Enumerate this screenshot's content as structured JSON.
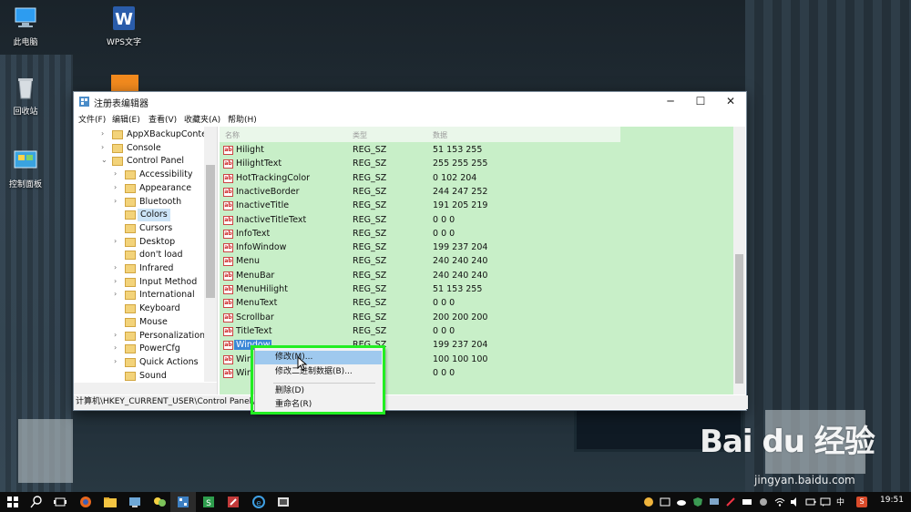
{
  "desktop": {
    "icons": [
      {
        "label": "此电脑",
        "name": "this-pc-icon"
      },
      {
        "label": "WPS文字",
        "name": "wps-writer-icon"
      },
      {
        "label": "回收站",
        "name": "recycle-bin-icon"
      },
      {
        "label": "控制面板",
        "name": "control-panel-icon"
      }
    ]
  },
  "window": {
    "title": "注册表编辑器",
    "buttons": {
      "minimize": "─",
      "maximize": "☐",
      "close": "✕"
    },
    "menu": [
      "文件(F)",
      "编辑(E)",
      "查看(V)",
      "收藏夹(A)",
      "帮助(H)"
    ]
  },
  "tree": {
    "nodes": [
      {
        "label": "AppXBackupConter",
        "level": 0,
        "arrow": "›"
      },
      {
        "label": "Console",
        "level": 0,
        "arrow": "›"
      },
      {
        "label": "Control Panel",
        "level": 0,
        "arrow": "⌄"
      },
      {
        "label": "Accessibility",
        "level": 1,
        "arrow": "›"
      },
      {
        "label": "Appearance",
        "level": 1,
        "arrow": "›"
      },
      {
        "label": "Bluetooth",
        "level": 1,
        "arrow": "›"
      },
      {
        "label": "Colors",
        "level": 1,
        "arrow": "",
        "selected": true
      },
      {
        "label": "Cursors",
        "level": 1,
        "arrow": ""
      },
      {
        "label": "Desktop",
        "level": 1,
        "arrow": "›"
      },
      {
        "label": "don't load",
        "level": 1,
        "arrow": ""
      },
      {
        "label": "Infrared",
        "level": 1,
        "arrow": "›"
      },
      {
        "label": "Input Method",
        "level": 1,
        "arrow": "›"
      },
      {
        "label": "International",
        "level": 1,
        "arrow": "›"
      },
      {
        "label": "Keyboard",
        "level": 1,
        "arrow": ""
      },
      {
        "label": "Mouse",
        "level": 1,
        "arrow": ""
      },
      {
        "label": "Personalization",
        "level": 1,
        "arrow": "›"
      },
      {
        "label": "PowerCfg",
        "level": 1,
        "arrow": "›"
      },
      {
        "label": "Quick Actions",
        "level": 1,
        "arrow": "›"
      },
      {
        "label": "Sound",
        "level": 1,
        "arrow": ""
      }
    ]
  },
  "list": {
    "headers": {
      "name": "名称",
      "type": "类型",
      "data": "数据"
    },
    "rows": [
      {
        "name": "Hilight",
        "type": "REG_SZ",
        "data": "51 153 255"
      },
      {
        "name": "HilightText",
        "type": "REG_SZ",
        "data": "255 255 255"
      },
      {
        "name": "HotTrackingColor",
        "type": "REG_SZ",
        "data": "0 102 204"
      },
      {
        "name": "InactiveBorder",
        "type": "REG_SZ",
        "data": "244 247 252"
      },
      {
        "name": "InactiveTitle",
        "type": "REG_SZ",
        "data": "191 205 219"
      },
      {
        "name": "InactiveTitleText",
        "type": "REG_SZ",
        "data": "0 0 0"
      },
      {
        "name": "InfoText",
        "type": "REG_SZ",
        "data": "0 0 0"
      },
      {
        "name": "InfoWindow",
        "type": "REG_SZ",
        "data": "199 237 204"
      },
      {
        "name": "Menu",
        "type": "REG_SZ",
        "data": "240 240 240"
      },
      {
        "name": "MenuBar",
        "type": "REG_SZ",
        "data": "240 240 240"
      },
      {
        "name": "MenuHilight",
        "type": "REG_SZ",
        "data": "51 153 255"
      },
      {
        "name": "MenuText",
        "type": "REG_SZ",
        "data": "0 0 0"
      },
      {
        "name": "Scrollbar",
        "type": "REG_SZ",
        "data": "200 200 200"
      },
      {
        "name": "TitleText",
        "type": "REG_SZ",
        "data": "0 0 0"
      },
      {
        "name": "Window",
        "type": "REG_SZ",
        "data": "199 237 204",
        "selected": true
      },
      {
        "name": "Win",
        "type": "",
        "data": "100 100 100"
      },
      {
        "name": "Win",
        "type": "",
        "data": "0 0 0"
      }
    ]
  },
  "statusbar": {
    "path": "计算机\\HKEY_CURRENT_USER\\Control Panel\\C"
  },
  "context_menu": {
    "items": [
      "修改(M)...",
      "修改二进制数据(B)...",
      "删除(D)",
      "重命名(R)"
    ]
  },
  "watermark": {
    "text": "Bai du 经验",
    "sub": "jingyan.baidu.com"
  },
  "taskbar": {
    "time": "19:51",
    "ime": "中",
    "ime2": "S"
  },
  "colors": {
    "list_bg": "#c8efc8",
    "selection": "#3a86d6",
    "highlight_box": "#22ee22",
    "menu_hover": "#9fc9ee"
  }
}
